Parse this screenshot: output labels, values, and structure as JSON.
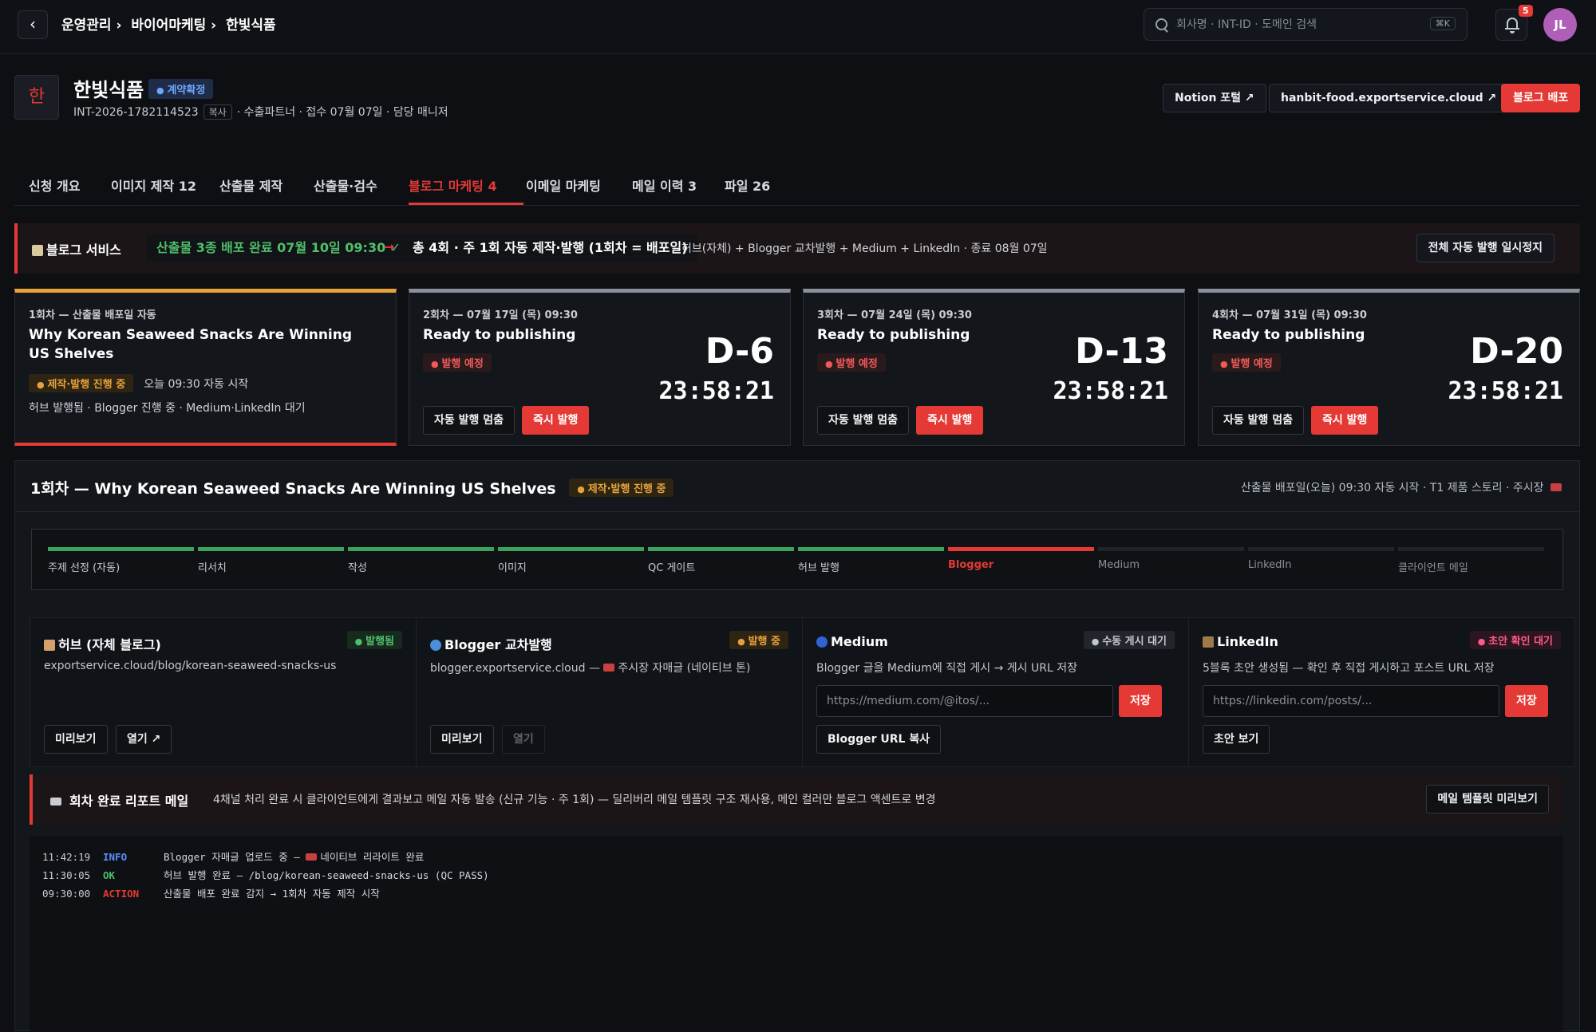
{
  "topbar": {
    "breadcrumb": [
      "운영관리 ›",
      "바이어마케팅 ›",
      "한빛식품"
    ],
    "search_placeholder": "회사명 · INT-ID · 도메인 검색",
    "search_shortcut": "⌘K",
    "notifications_count": "5",
    "avatar_initials": "JL"
  },
  "header": {
    "logo_char": "한",
    "company_name": "한빛식품",
    "status": "계약확정",
    "id": "INT-2026-1782114523",
    "copy_label": "복사",
    "meta": "· 수출파트너 · 접수 07월 07일 · 담당 매니저",
    "notion_label": "Notion 포털 ↗",
    "site_label": "hanbit-food.exportservice.cloud ↗",
    "deploy_label": "블로그 배포"
  },
  "tabs": [
    {
      "label": "신청 개요"
    },
    {
      "label": "이미지 제작 12"
    },
    {
      "label": "산출물 제작"
    },
    {
      "label": "산출물·검수"
    },
    {
      "label": "블로그 마케팅 4"
    },
    {
      "label": "이메일 마케팅"
    },
    {
      "label": "메일 이력 3"
    },
    {
      "label": "파일 26"
    }
  ],
  "blog_banner": {
    "label": "블로그 서비스",
    "deliverable": "산출물 3종 배포 완료 07월 10일 09:30 ✓",
    "arrow": "→",
    "schedule": "총 4회 · 주 1회 자동 제작·발행 (1회차 = 배포일)",
    "channels": "허브(자체) + Blogger 교차발행 + Medium + LinkedIn · 종료 08월 07일",
    "pause_label": "전체 자동 발행 일시정지"
  },
  "episodes": [
    {
      "label": "1회차 — 산출물 배포일 자동",
      "title": "Why Korean Seaweed Snacks Are Winning US Shelves",
      "status": "제작·발행 진행 중",
      "start": "오늘 09:30 자동 시작",
      "progress": "허브 발행됨 · Blogger 진행 중 · Medium·LinkedIn 대기"
    },
    {
      "label": "2회차 — 07월 17일 (목) 09:30",
      "title": "Ready to publishing",
      "status": "발행 예정",
      "dday": "D-6",
      "countdown": "23:58:21",
      "stop_label": "자동 발행 멈춤",
      "now_label": "즉시 발행"
    },
    {
      "label": "3회차 — 07월 24일 (목) 09:30",
      "title": "Ready to publishing",
      "status": "발행 예정",
      "dday": "D-13",
      "countdown": "23:58:21",
      "stop_label": "자동 발행 멈춤",
      "now_label": "즉시 발행"
    },
    {
      "label": "4회차 — 07월 31일 (목) 09:30",
      "title": "Ready to publishing",
      "status": "발행 예정",
      "dday": "D-20",
      "countdown": "23:58:21",
      "stop_label": "자동 발행 멈춤",
      "now_label": "즉시 발행"
    }
  ],
  "detail": {
    "title": "1회차 — Why Korean Seaweed Snacks Are Winning US Shelves",
    "status": "제작·발행 진행 중",
    "info": "산출물 배포일(오늘) 09:30 자동 시작 · T1 제품 스토리 · 주시장",
    "pipeline": [
      {
        "label": "주제 선정 (자동)",
        "state": "done"
      },
      {
        "label": "리서치",
        "state": "done"
      },
      {
        "label": "작성",
        "state": "done"
      },
      {
        "label": "이미지",
        "state": "done"
      },
      {
        "label": "QC 게이트",
        "state": "done"
      },
      {
        "label": "허브 발행",
        "state": "done"
      },
      {
        "label": "Blogger",
        "state": "active"
      },
      {
        "label": "Medium",
        "state": "pending"
      },
      {
        "label": "LinkedIn",
        "state": "pending"
      },
      {
        "label": "클라이언트 메일",
        "state": "pending"
      }
    ],
    "channels": {
      "hub": {
        "name": "허브 (자체 블로그)",
        "status": "발행됨",
        "desc": "exportservice.cloud/blog/korean-seaweed-snacks-us",
        "preview": "미리보기",
        "open": "열기 ↗"
      },
      "blogger": {
        "name": "Blogger 교차발행",
        "status": "발행 중",
        "desc_prefix": "blogger.exportservice.cloud —",
        "desc_suffix": "주시장 자매글 (네이티브 톤)",
        "preview": "미리보기",
        "open": "열기"
      },
      "medium": {
        "name": "Medium",
        "status": "수동 게시 대기",
        "desc": "Blogger 글을 Medium에 직접 게시 → 게시 URL 저장",
        "placeholder": "https://medium.com/@itos/...",
        "save": "저장",
        "copy": "Blogger URL 복사"
      },
      "linkedin": {
        "name": "LinkedIn",
        "status": "초안 확인 대기",
        "desc": "5블록 초안 생성됨 — 확인 후 직접 게시하고 포스트 URL 저장",
        "placeholder": "https://linkedin.com/posts/...",
        "save": "저장",
        "draft": "초안 보기"
      }
    },
    "report": {
      "label": "회차 완료 리포트 메일",
      "desc": "4채널 처리 완료 시 클라이언트에게 결과보고 메일 자동 발송 (신규 기능 · 주 1회) — 딜리버리 메일 템플릿 구조 재사용, 메인 컬러만 블로그 액센트로 변경",
      "button": "메일 템플릿 미리보기"
    },
    "logs": [
      {
        "time": "11:42:19",
        "level": "INFO",
        "msg_prefix": "Blogger 자매글 업로드 중 —",
        "msg_suffix": "네이티브 리라이트 완료"
      },
      {
        "time": "11:30:05",
        "level": "OK",
        "msg": "허브 발행 완료 — /blog/korean-seaweed-snacks-us (QC PASS)"
      },
      {
        "time": "09:30:00",
        "level": "ACTION",
        "msg": "산출물 배포 완료 감지 → 1회차 자동 제작 시작"
      }
    ]
  }
}
